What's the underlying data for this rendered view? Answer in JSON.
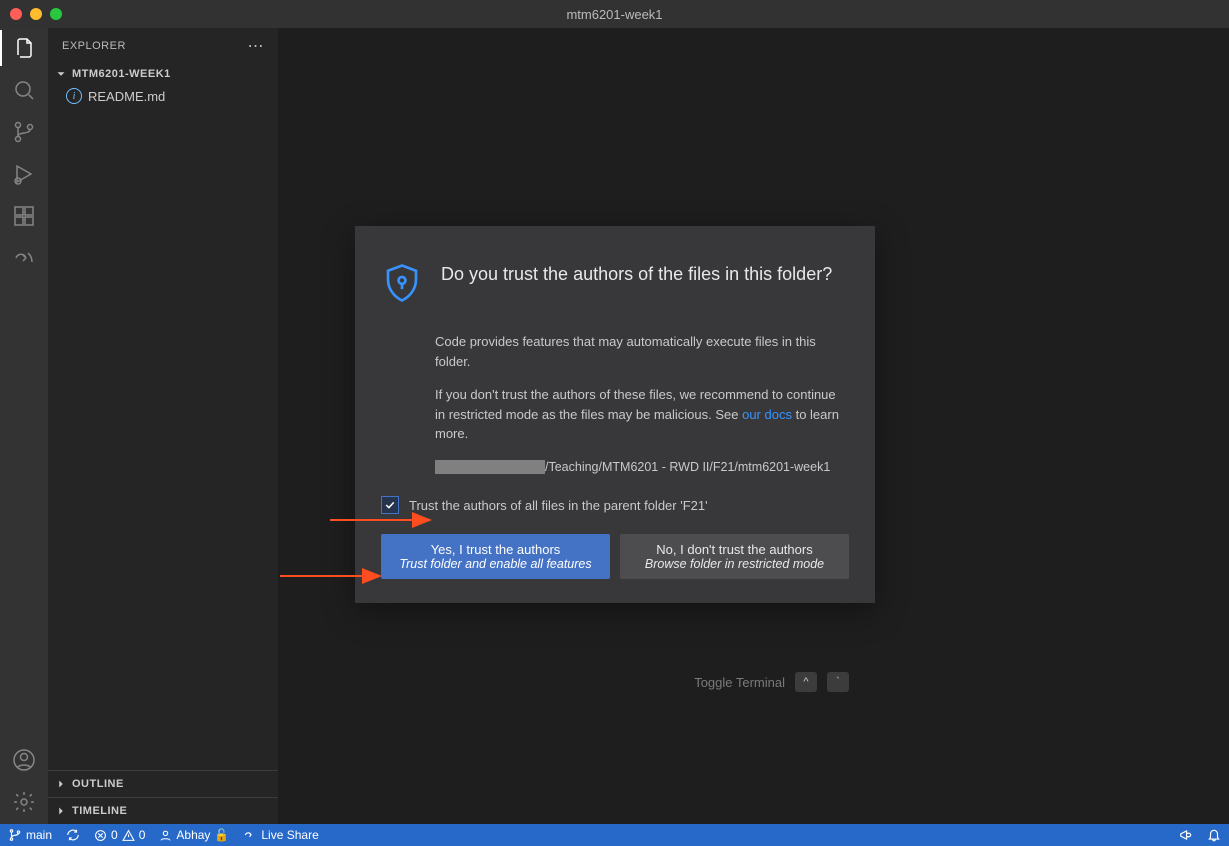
{
  "titlebar": {
    "title": "mtm6201-week1"
  },
  "sidebar": {
    "header": "EXPLORER",
    "workspace": "MTM6201-WEEK1",
    "files": [
      {
        "name": "README.md"
      }
    ],
    "outline": "OUTLINE",
    "timeline": "TIMELINE"
  },
  "hints": {
    "toggle_terminal": "Toggle Terminal",
    "key1": "^",
    "key2": "`"
  },
  "dialog": {
    "title": "Do you trust the authors of the files in this folder?",
    "p1": "Code provides features that may automatically execute files in this folder.",
    "p2a": "If you don't trust the authors of these files, we recommend to continue in restricted mode as the files may be malicious. See ",
    "p2_link": "our docs",
    "p2b": " to learn more.",
    "path_tail": "/Teaching/MTM6201 - RWD II/F21/mtm6201-week1",
    "checkbox_label": "Trust the authors of all files in the parent folder 'F21'",
    "yes_main": "Yes, I trust the authors",
    "yes_sub": "Trust folder and enable all features",
    "no_main": "No, I don't trust the authors",
    "no_sub": "Browse folder in restricted mode"
  },
  "status": {
    "branch": "main",
    "errors": "0",
    "warnings": "0",
    "user": "Abhay",
    "live_share": "Live Share"
  }
}
